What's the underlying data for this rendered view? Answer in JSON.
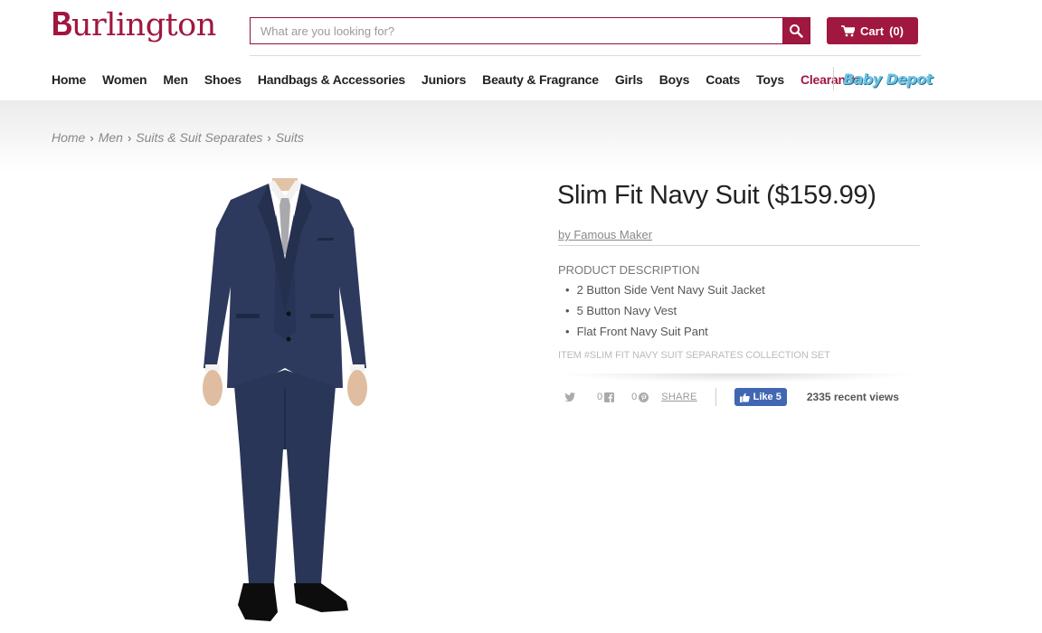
{
  "header": {
    "logo_text": "Burlington",
    "logo_rest": "urlington",
    "search_placeholder": "What are you looking for?",
    "cart_label": "Cart",
    "cart_count": "(0)"
  },
  "nav": {
    "items": [
      {
        "label": "Home"
      },
      {
        "label": "Women"
      },
      {
        "label": "Men"
      },
      {
        "label": "Shoes"
      },
      {
        "label": "Handbags & Accessories"
      },
      {
        "label": "Juniors"
      },
      {
        "label": "Beauty & Fragrance"
      },
      {
        "label": "Girls"
      },
      {
        "label": "Boys"
      },
      {
        "label": "Coats"
      },
      {
        "label": "Toys"
      },
      {
        "label": "Clearance"
      }
    ],
    "baby_depot": "Baby Depot"
  },
  "breadcrumb": [
    "Home",
    "Men",
    "Suits & Suit Separates",
    "Suits"
  ],
  "product": {
    "title": "Slim Fit Navy Suit ($159.99)",
    "brand": "by Famous Maker",
    "description_heading": "PRODUCT DESCRIPTION",
    "description_items": [
      "2 Button Side Vent Navy Suit Jacket",
      "5 Button Navy Vest",
      "Flat Front Navy Suit Pant"
    ],
    "item_number": "ITEM #SLIM FIT NAVY SUIT SEPARATES COLLECTION SET"
  },
  "social": {
    "facebook_count": "0",
    "pinterest_count": "0",
    "share_label": "SHARE",
    "like_label": "Like 5",
    "recent_views": "2335 recent views"
  },
  "colors": {
    "brand": "#a0173f",
    "facebook": "#4267b2",
    "suit_navy": "#2d3a5e"
  }
}
